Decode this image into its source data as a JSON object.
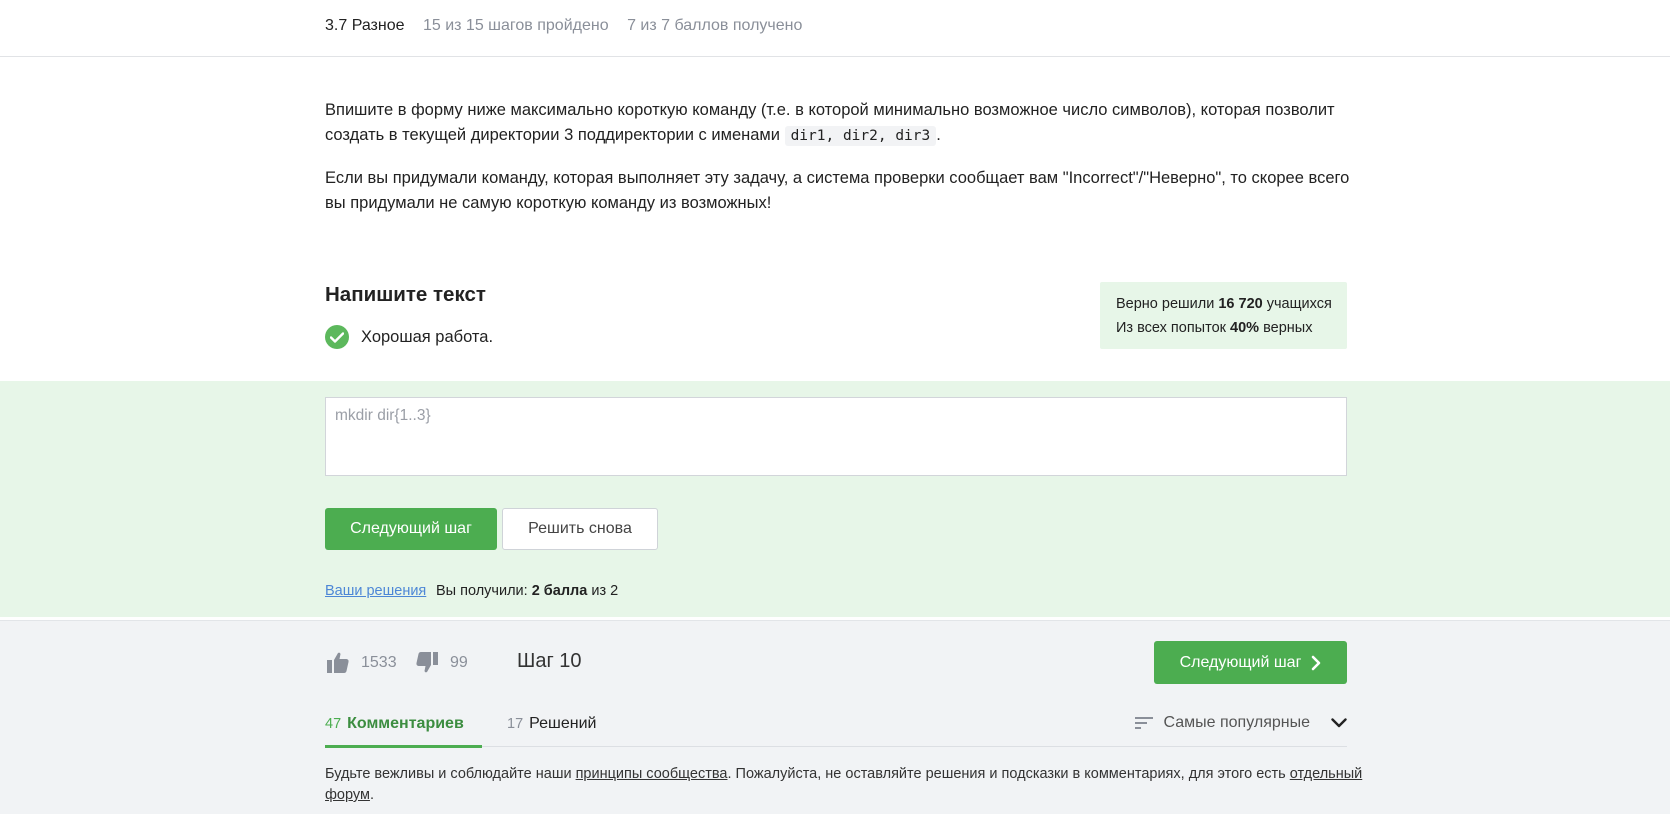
{
  "topbar": {
    "lesson": "3.7 Разное",
    "steps_progress": "15 из 15 шагов пройдено",
    "points": "7 из 7 баллов  получено"
  },
  "task": {
    "p1_before": "Впишите в форму ниже максимально короткую команду (т.е. в которой минимально возможное число символов), которая позволит создать в текущей директории 3 поддиректории с именами ",
    "p1_code": "dir1, dir2, dir3",
    "p1_after": ".",
    "p2": "Если вы придумали команду, которая выполняет эту задачу, а система проверки сообщает вам \"Incorrect\"/\"Неверно\", то скорее всего вы придумали не самую короткую команду из возможных!"
  },
  "quiz": {
    "title": "Напишите текст",
    "feedback": "Хорошая работа.",
    "stats_line1_before": "Верно решили ",
    "stats_line1_value": "16 720",
    "stats_line1_after": " учащихся",
    "stats_line2_before": "Из всех попыток ",
    "stats_line2_value": "40%",
    "stats_line2_after": " верных",
    "answer_value": "mkdir dir{1..3}",
    "next_button": "Следующий шаг",
    "retry_button": "Решить снова",
    "solutions_link": "Ваши решения",
    "score_before": "Вы получили: ",
    "score_value": "2 балла",
    "score_after": " из 2"
  },
  "footer": {
    "likes": "1533",
    "dislikes": "99",
    "step_label": "Шаг 10",
    "next_button": "Следующий шаг"
  },
  "tabs": [
    {
      "count": "47",
      "label": "Комментариев"
    },
    {
      "count": "17",
      "label": "Решений"
    }
  ],
  "sort": {
    "label": "Самые популярные"
  },
  "rules": {
    "t1": "Будьте вежливы и соблюдайте наши ",
    "link1": "принципы сообщества",
    "t2": ". Пожалуйста, не оставляйте решения и подсказки в комментариях, для этого есть ",
    "link2": "отдельный форум",
    "t3": "."
  },
  "colors": {
    "accent": "#4cad50",
    "success_bg": "#e7f6e8",
    "link": "#4d87d6"
  }
}
